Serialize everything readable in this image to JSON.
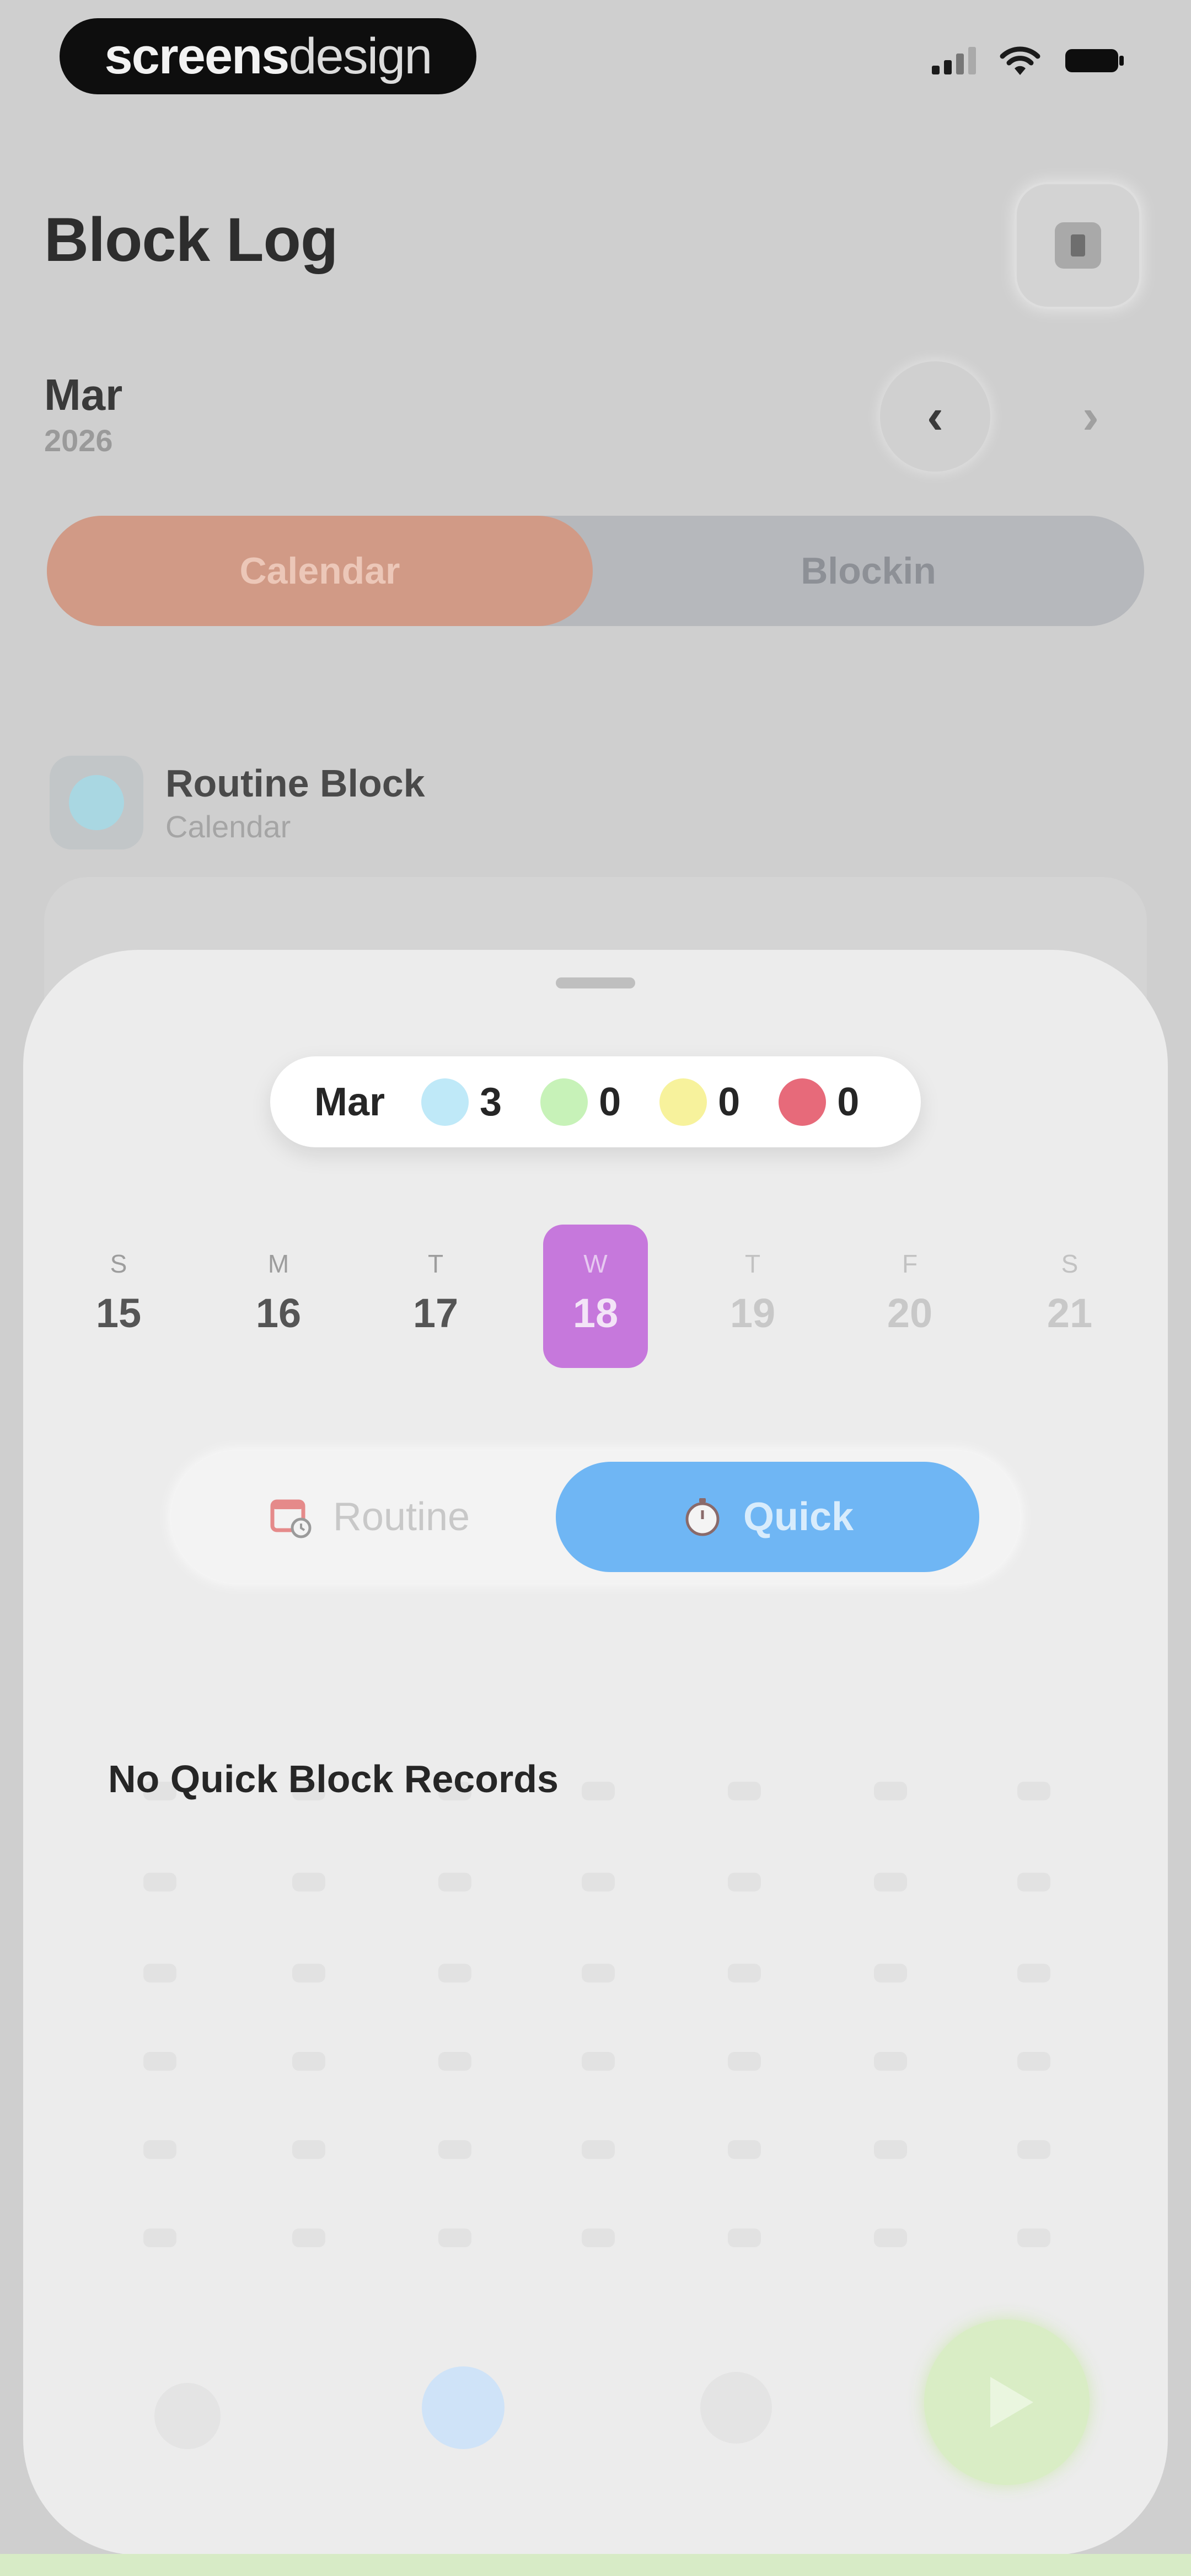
{
  "status_bar": {
    "logo_bold": "screens",
    "logo_light": "design"
  },
  "header": {
    "title": "Block Log",
    "month": "Mar",
    "year": "2026",
    "prev_icon": "chevron-left-icon",
    "next_icon": "chevron-right-icon"
  },
  "segmented": {
    "items": [
      {
        "label": "Calendar",
        "active": true
      },
      {
        "label": "Blockin",
        "active": false
      }
    ]
  },
  "routine_item": {
    "title": "Routine Block",
    "subtitle": "Calendar"
  },
  "sheet": {
    "summary": {
      "month": "Mar",
      "stats": [
        {
          "color": "#bfe9f8",
          "count": "3"
        },
        {
          "color": "#c7f2b8",
          "count": "0"
        },
        {
          "color": "#f7f29c",
          "count": "0"
        },
        {
          "color": "#e76a7a",
          "count": "0"
        }
      ]
    },
    "week": [
      {
        "weekday": "S",
        "day": "15",
        "state": "past"
      },
      {
        "weekday": "M",
        "day": "16",
        "state": "past"
      },
      {
        "weekday": "T",
        "day": "17",
        "state": "past"
      },
      {
        "weekday": "W",
        "day": "18",
        "state": "selected"
      },
      {
        "weekday": "T",
        "day": "19",
        "state": "future"
      },
      {
        "weekday": "F",
        "day": "20",
        "state": "future"
      },
      {
        "weekday": "S",
        "day": "21",
        "state": "future"
      }
    ],
    "toggle": {
      "routine_label": "Routine",
      "quick_label": "Quick",
      "active": "Quick",
      "routine_icon": "calendar-clock-icon",
      "quick_icon": "stopwatch-icon"
    },
    "empty_title": "No Quick Block Records"
  },
  "colors": {
    "accent_calendar": "#d19a86",
    "selected_day": "#c678dc",
    "quick_active": "#6fb6f4",
    "play_button": "#d9edc5"
  }
}
